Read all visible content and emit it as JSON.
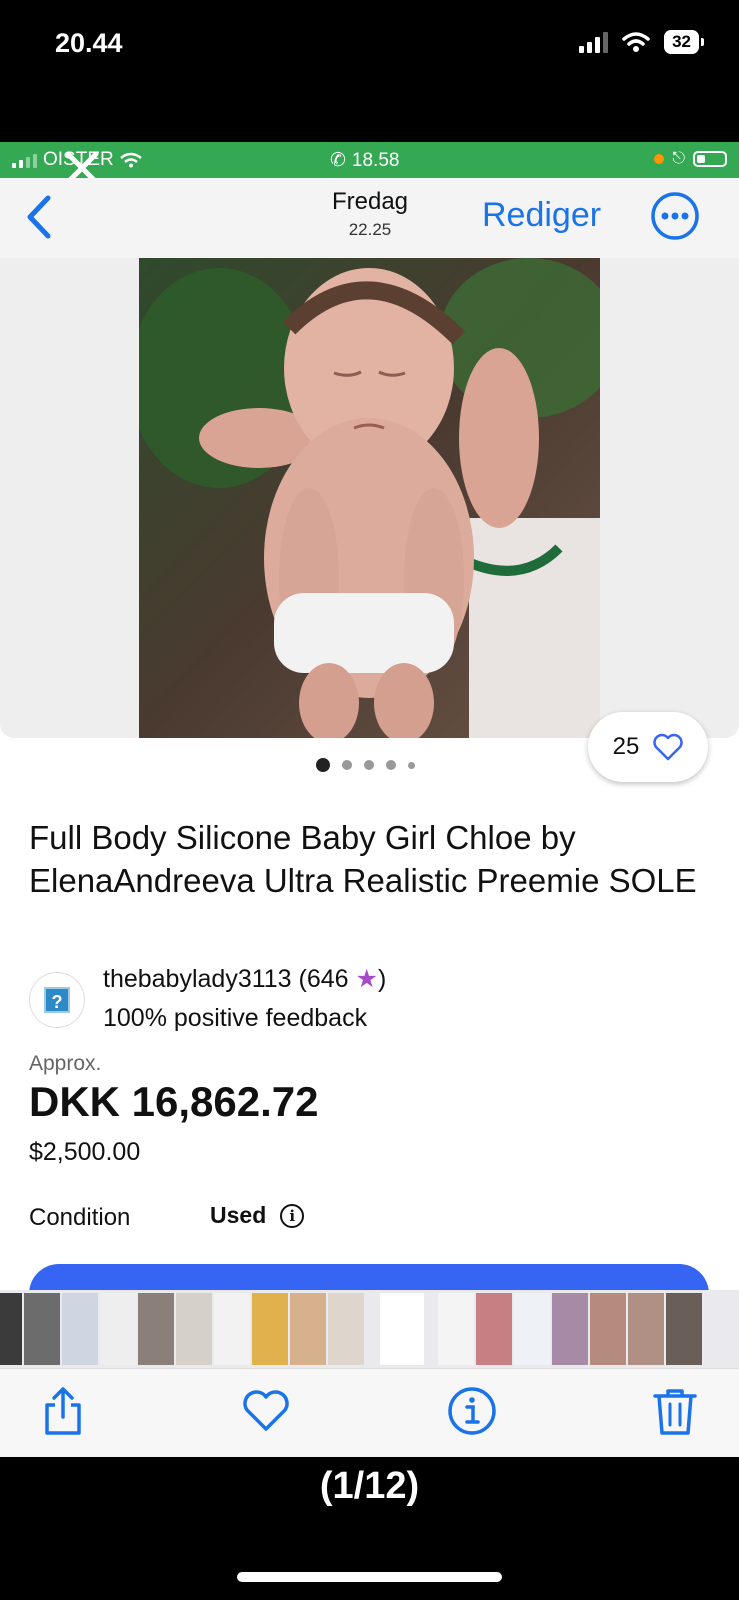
{
  "outer_status": {
    "time": "20.44",
    "battery": "32"
  },
  "inner_status": {
    "carrier": "OISTER",
    "call_time": "18.58"
  },
  "nav": {
    "day": "Fredag",
    "time": "22.25",
    "edit_label": "Rediger"
  },
  "listing": {
    "likes": "25",
    "title": "Full Body Silicone Baby Girl Chloe by ElenaAndreeva Ultra Realistic Preemie SOLE",
    "seller": {
      "name": "thebabylady3113 (646 ",
      "star": "★",
      "close": ")",
      "feedback": "100% positive feedback"
    },
    "approx_label": "Approx.",
    "price_dkk": "DKK 16,862.72",
    "price_usd": "$2,500.00",
    "condition_label": "Condition",
    "condition_value": "Used"
  },
  "counter": "(1/12)",
  "colors": {
    "ebay_blue": "#3665f3",
    "call_green": "#34a853",
    "ios_blue": "#1a73e8"
  },
  "thumbnails": [
    "#3b3b3b",
    "#6c6c6c",
    "#cfd6e2",
    "#eeeeee",
    "#8a7f79",
    "#d5d0c8",
    "#f2f2f2",
    "#e0b24d",
    "#d7b08e",
    "#ded6cc",
    "#ffffff",
    "#f4f4f4",
    "#c87f83",
    "#eef2f7",
    "#a78aa5",
    "#b48b7d",
    "#b08f84",
    "#6a5e58"
  ]
}
